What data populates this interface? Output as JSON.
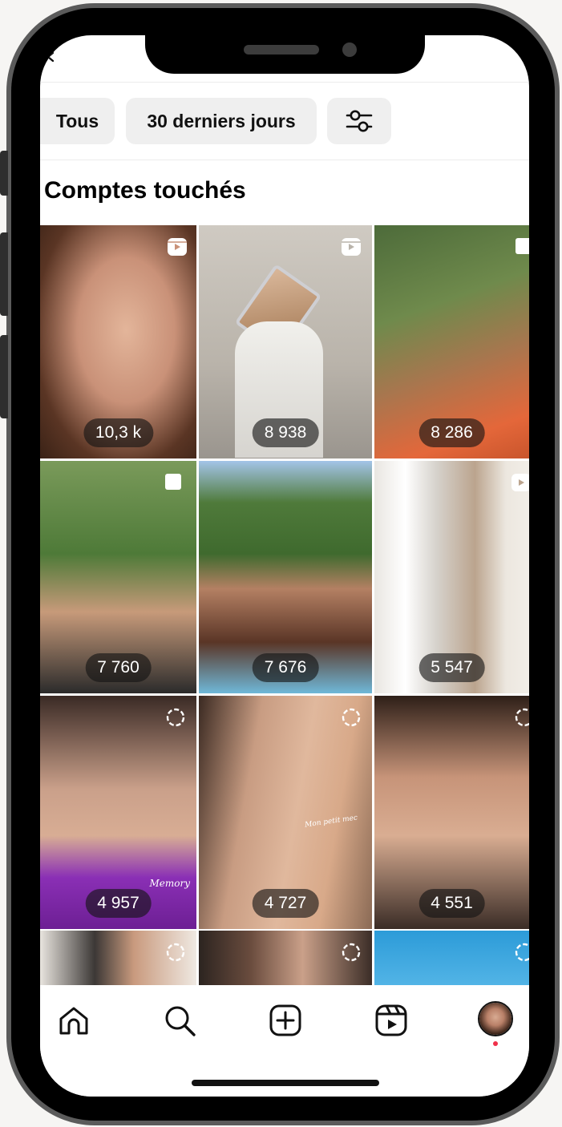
{
  "filters": {
    "all_label": "Tous",
    "period_label": "30 derniers jours",
    "settings_icon": "sliders-icon"
  },
  "section": {
    "title": "Comptes touchés"
  },
  "posts": [
    {
      "count": "10,3 k",
      "type": "reel",
      "icon": "reel-icon"
    },
    {
      "count": "8 938",
      "type": "reel",
      "icon": "reel-icon"
    },
    {
      "count": "8 286",
      "type": "post",
      "icon": "carousel-icon"
    },
    {
      "count": "7 760",
      "type": "post",
      "icon": "carousel-icon"
    },
    {
      "count": "7 676",
      "type": "post",
      "icon": "none"
    },
    {
      "count": "5 547",
      "type": "reel",
      "icon": "reel-icon"
    },
    {
      "count": "4 957",
      "type": "story",
      "icon": "story-icon",
      "caption": "Memory"
    },
    {
      "count": "4 727",
      "type": "story",
      "icon": "story-icon",
      "caption": "Mon petit mec"
    },
    {
      "count": "4 551",
      "type": "story",
      "icon": "story-icon"
    },
    {
      "count": "",
      "type": "story",
      "icon": "story-icon"
    },
    {
      "count": "",
      "type": "story",
      "icon": "story-icon"
    },
    {
      "count": "",
      "type": "story",
      "icon": "story-icon"
    }
  ],
  "tabbar": {
    "items": [
      "home-icon",
      "search-icon",
      "create-icon",
      "reels-icon",
      "profile-avatar"
    ],
    "notification_color": "#f0304a"
  },
  "colors": {
    "chip_bg": "#efefef",
    "badge_bg": "rgba(20,20,20,0.62)"
  }
}
